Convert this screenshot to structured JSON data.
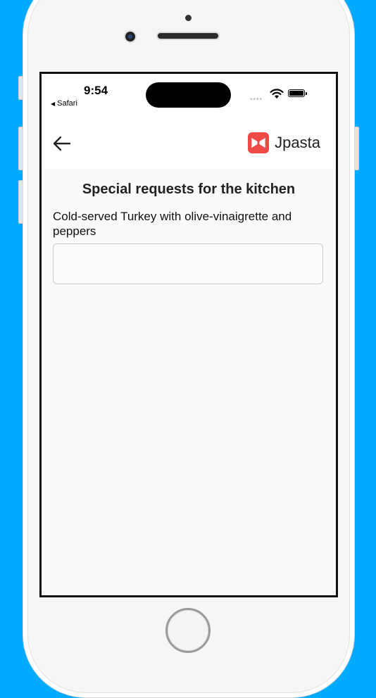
{
  "status_bar": {
    "time": "9:54",
    "back_app": "Safari",
    "back_glyph": "◀",
    "signal_dots": "••••"
  },
  "nav": {
    "back_icon": "arrow-left-icon",
    "brand_name": "Jpasta",
    "brand_logo_icon": "bowtie-pasta-icon",
    "brand_color": "#f04a47"
  },
  "main": {
    "heading": "Special requests for the kitchen",
    "item_name": "Cold-served Turkey with olive-vinaigrette and peppers",
    "request_input": {
      "value": "",
      "placeholder": ""
    }
  },
  "colors": {
    "background": "#00aaff",
    "screen": "#fafafa",
    "text": "#222222"
  }
}
